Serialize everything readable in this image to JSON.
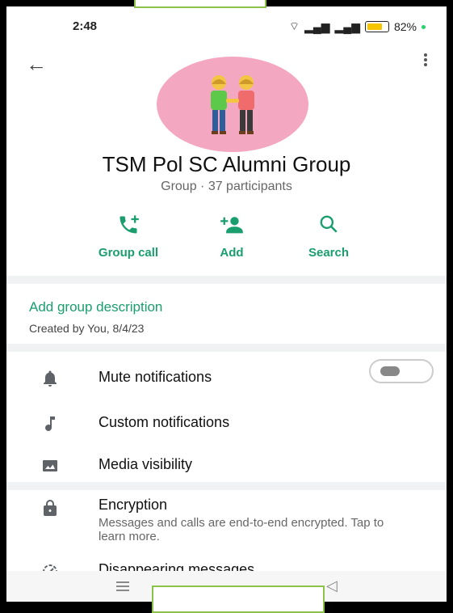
{
  "status": {
    "time": "2:48",
    "battery": "82%"
  },
  "header": {
    "group_name": "TSM Pol SC Alumni Group",
    "meta": "Group · 37 participants"
  },
  "actions": [
    {
      "label": "Group call"
    },
    {
      "label": "Add"
    },
    {
      "label": "Search"
    }
  ],
  "description": {
    "title": "Add group description",
    "created": "Created by You, 8/4/23"
  },
  "settings": {
    "mute": "Mute notifications",
    "custom": "Custom notifications",
    "media": "Media visibility"
  },
  "encryption": {
    "title": "Encryption",
    "subtitle": "Messages and calls are end-to-end encrypted. Tap to learn more."
  },
  "disappearing": "Disappearing messages",
  "colors": {
    "accent": "#1a9e6e",
    "avatar_bg": "#f4a7c1"
  }
}
